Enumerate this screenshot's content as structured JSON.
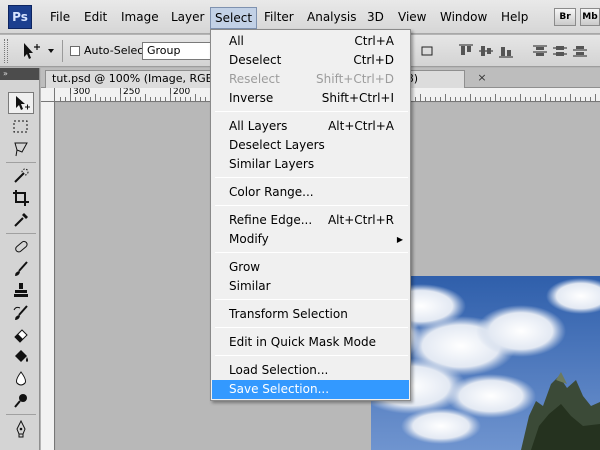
{
  "app": {
    "logo_text": "Ps",
    "menu": [
      {
        "label": "File"
      },
      {
        "label": "Edit"
      },
      {
        "label": "Image"
      },
      {
        "label": "Layer"
      },
      {
        "label": "Select"
      },
      {
        "label": "Filter"
      },
      {
        "label": "Analysis"
      },
      {
        "label": "3D"
      },
      {
        "label": "View"
      },
      {
        "label": "Window"
      },
      {
        "label": "Help"
      }
    ],
    "active_menu": "Select",
    "bridge_button": "Br",
    "minibridge_button": "Mb"
  },
  "options_bar": {
    "auto_select_label": "Auto-Select:",
    "auto_select_checked": false,
    "group_select_value": "Group"
  },
  "document": {
    "tab_title": "tut.psd @ 100% (Image, RGB/8",
    "tab_title_suffix": "8/8)",
    "close_glyph": "×"
  },
  "ruler": {
    "labels": [
      "300",
      "250",
      "200"
    ]
  },
  "select_menu": {
    "items": [
      {
        "label": "All",
        "shortcut": "Ctrl+A",
        "enabled": true
      },
      {
        "label": "Deselect",
        "shortcut": "Ctrl+D",
        "enabled": true
      },
      {
        "label": "Reselect",
        "shortcut": "Shift+Ctrl+D",
        "enabled": false
      },
      {
        "label": "Inverse",
        "shortcut": "Shift+Ctrl+I",
        "enabled": true
      },
      {
        "label": "All Layers",
        "shortcut": "Alt+Ctrl+A",
        "enabled": true
      },
      {
        "label": "Deselect Layers",
        "shortcut": "",
        "enabled": true
      },
      {
        "label": "Similar Layers",
        "shortcut": "",
        "enabled": true
      },
      {
        "label": "Color Range...",
        "shortcut": "",
        "enabled": true
      },
      {
        "label": "Refine Edge...",
        "shortcut": "Alt+Ctrl+R",
        "enabled": true
      },
      {
        "label": "Modify",
        "shortcut": "",
        "enabled": true,
        "submenu": true
      },
      {
        "label": "Grow",
        "shortcut": "",
        "enabled": true
      },
      {
        "label": "Similar",
        "shortcut": "",
        "enabled": true
      },
      {
        "label": "Transform Selection",
        "shortcut": "",
        "enabled": true
      },
      {
        "label": "Edit in Quick Mask Mode",
        "shortcut": "",
        "enabled": true
      },
      {
        "label": "Load Selection...",
        "shortcut": "",
        "enabled": true
      },
      {
        "label": "Save Selection...",
        "shortcut": "",
        "enabled": true,
        "highlighted": true
      }
    ],
    "highlight_color": "#3399ff"
  },
  "tools": [
    {
      "name": "move-tool-icon",
      "selected": true
    },
    {
      "name": "rectangular-marquee-tool-icon"
    },
    {
      "name": "lasso-tool-icon"
    },
    {
      "name": "quick-selection-tool-icon"
    },
    {
      "name": "crop-tool-icon"
    },
    {
      "name": "eyedropper-tool-icon"
    },
    {
      "name": "spot-healing-brush-icon"
    },
    {
      "name": "brush-tool-icon"
    },
    {
      "name": "clone-stamp-tool-icon"
    },
    {
      "name": "history-brush-icon"
    },
    {
      "name": "eraser-tool-icon"
    },
    {
      "name": "paint-bucket-tool-icon"
    },
    {
      "name": "blur-tool-icon"
    },
    {
      "name": "dodge-tool-icon"
    },
    {
      "name": "pen-tool-icon"
    }
  ]
}
